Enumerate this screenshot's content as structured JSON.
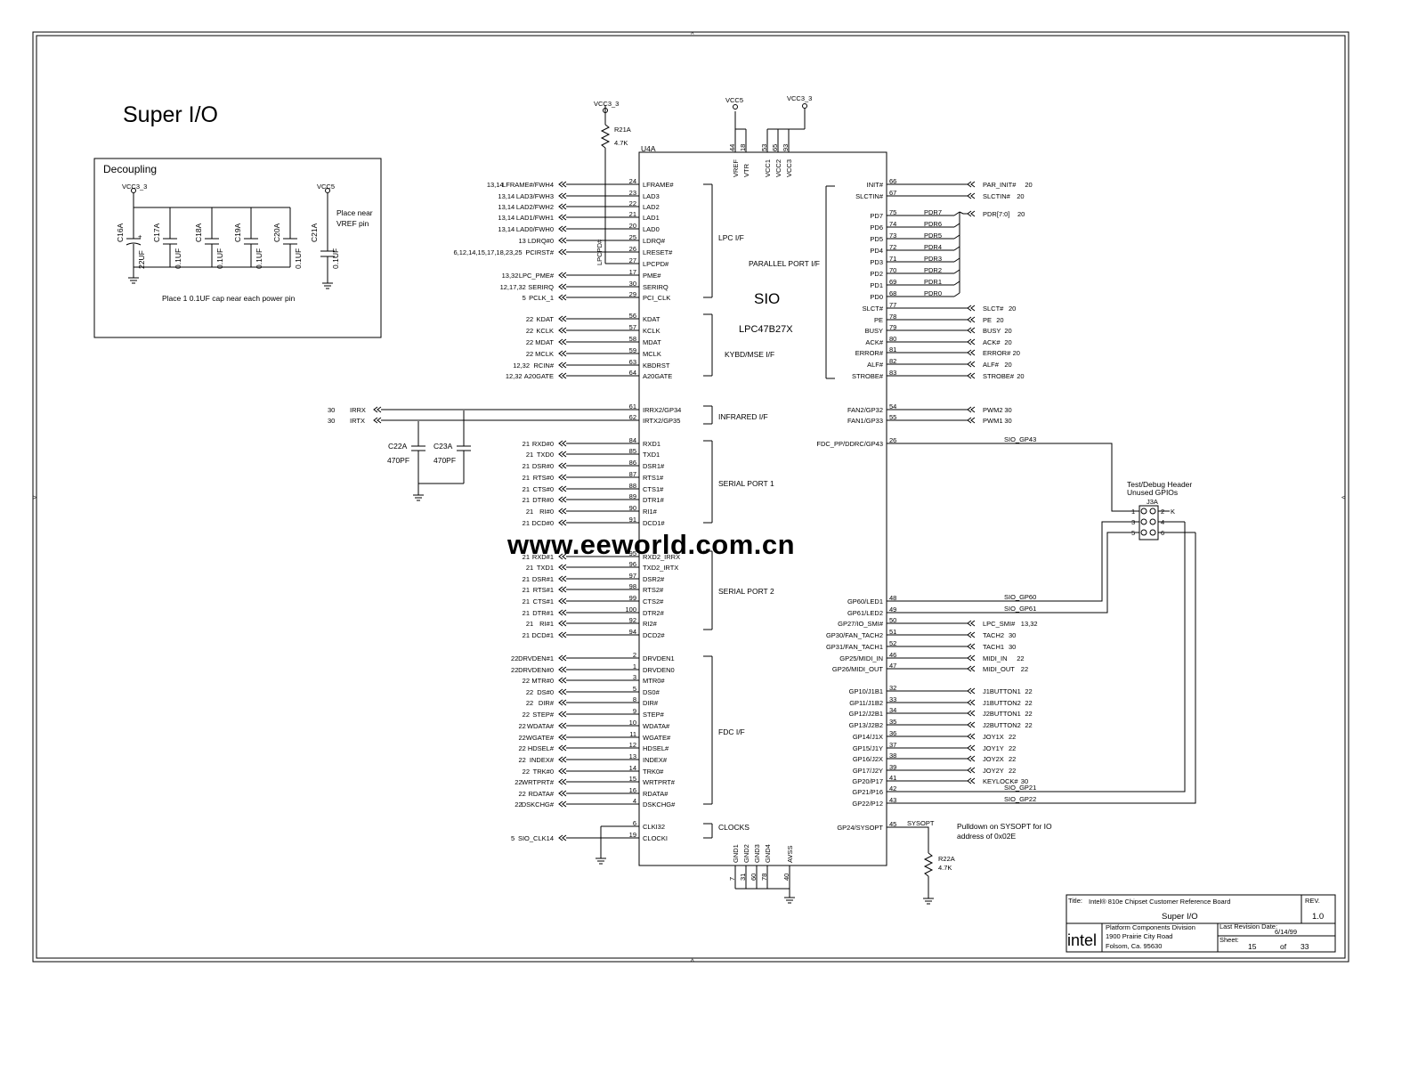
{
  "sheet": {
    "title": "Super I/O"
  },
  "decoupling": {
    "label": "Decoupling",
    "vcc3_label": "VCC3_3",
    "vcc5_label": "VCC5",
    "note_near": "Place near\nVREF pin",
    "note_each": "Place 1 0.1UF cap near each power pin",
    "caps": [
      {
        "ref": "C16A",
        "value": "22UF",
        "polarized": true
      },
      {
        "ref": "C17A",
        "value": "0.1UF"
      },
      {
        "ref": "C18A",
        "value": "0.1UF"
      },
      {
        "ref": "C19A",
        "value": "0.1UF"
      },
      {
        "ref": "C20A",
        "value": "0.1UF"
      },
      {
        "ref": "C21A",
        "value": "0.1UF"
      }
    ]
  },
  "pullup": {
    "rail": "VCC3_3",
    "ref": "R21A",
    "value": "4.7K"
  },
  "chip": {
    "refdes": "U4A",
    "name": "SIO",
    "part": "LPC47B27X",
    "top_rail_left": "VCC5",
    "top_rail_right": "VCC3_3",
    "top_pins": [
      {
        "name": "VREF",
        "num": "44"
      },
      {
        "name": "VTR",
        "num": "18"
      },
      {
        "name": "VCC1",
        "num": "53"
      },
      {
        "name": "VCC2",
        "num": "65"
      },
      {
        "name": "VCC3",
        "num": "93"
      }
    ],
    "bottom_pins": [
      {
        "name": "GND1",
        "num": "7"
      },
      {
        "name": "GND2",
        "num": "31"
      },
      {
        "name": "GND3",
        "num": "60"
      },
      {
        "name": "GND4",
        "num": "78"
      },
      {
        "name": "AVSS",
        "num": "40"
      }
    ],
    "groups": {
      "lpc": "LPC I/F",
      "kybd": "KYBD/MSE I/F",
      "infrared": "INFRARED I/F",
      "serial1": "SERIAL PORT 1",
      "serial2": "SERIAL PORT 2",
      "fdc": "FDC I/F",
      "clocks": "CLOCKS",
      "parallel": "PARALLEL PORT I/F"
    }
  },
  "left_pins": [
    {
      "pin": "LFRAME#",
      "num": "24",
      "net": "LFRAME#/FWH4",
      "ref": "13,14"
    },
    {
      "pin": "LAD3",
      "num": "23",
      "net": "LAD3/FWH3",
      "ref": "13,14"
    },
    {
      "pin": "LAD2",
      "num": "22",
      "net": "LAD2/FWH2",
      "ref": "13,14"
    },
    {
      "pin": "LAD1",
      "num": "21",
      "net": "LAD1/FWH1",
      "ref": "13,14"
    },
    {
      "pin": "LAD0",
      "num": "20",
      "net": "LAD0/FWH0",
      "ref": "13,14"
    },
    {
      "pin": "LDRQ#",
      "num": "25",
      "net": "LDRQ#0",
      "ref": "13"
    },
    {
      "pin": "LRESET#",
      "num": "26",
      "net": "PCIRST#",
      "ref": "6,12,14,15,17,18,23,25"
    },
    {
      "pin": "LPCPD#",
      "num": "27",
      "net": "",
      "ref": ""
    },
    {
      "pin": "PME#",
      "num": "17",
      "net": "LPC_PME#",
      "ref": "13,32"
    },
    {
      "pin": "SERIRQ",
      "num": "30",
      "net": "SERIRQ",
      "ref": "12,17,32"
    },
    {
      "pin": "PCI_CLK",
      "num": "29",
      "net": "PCLK_1",
      "ref": "5"
    },
    {
      "pin": "KDAT",
      "num": "56",
      "net": "KDAT",
      "ref": "22"
    },
    {
      "pin": "KCLK",
      "num": "57",
      "net": "KCLK",
      "ref": "22"
    },
    {
      "pin": "MDAT",
      "num": "58",
      "net": "MDAT",
      "ref": "22"
    },
    {
      "pin": "MCLK",
      "num": "59",
      "net": "MCLK",
      "ref": "22"
    },
    {
      "pin": "KBDRST",
      "num": "63",
      "net": "RCIN#",
      "ref": "12,32"
    },
    {
      "pin": "A20GATE",
      "num": "64",
      "net": "A20GATE",
      "ref": "12,32"
    },
    {
      "pin": "IRRX2/GP34",
      "num": "61",
      "net": "IRRX",
      "ref": "30"
    },
    {
      "pin": "IRTX2/GP35",
      "num": "62",
      "net": "IRTX",
      "ref": "30"
    },
    {
      "pin": "RXD1",
      "num": "84",
      "net": "RXD#0",
      "ref": "21"
    },
    {
      "pin": "TXD1",
      "num": "85",
      "net": "TXD0",
      "ref": "21"
    },
    {
      "pin": "DSR1#",
      "num": "86",
      "net": "DSR#0",
      "ref": "21"
    },
    {
      "pin": "RTS1#",
      "num": "87",
      "net": "RTS#0",
      "ref": "21"
    },
    {
      "pin": "CTS1#",
      "num": "88",
      "net": "CTS#0",
      "ref": "21"
    },
    {
      "pin": "DTR1#",
      "num": "89",
      "net": "DTR#0",
      "ref": "21"
    },
    {
      "pin": "RI1#",
      "num": "90",
      "net": "RI#0",
      "ref": "21"
    },
    {
      "pin": "DCD1#",
      "num": "91",
      "net": "DCD#0",
      "ref": "21"
    },
    {
      "pin": "RXD2_IRRX",
      "num": "95",
      "net": "RXD#1",
      "ref": "21"
    },
    {
      "pin": "TXD2_IRTX",
      "num": "96",
      "net": "TXD1",
      "ref": "21"
    },
    {
      "pin": "DSR2#",
      "num": "97",
      "net": "DSR#1",
      "ref": "21"
    },
    {
      "pin": "RTS2#",
      "num": "98",
      "net": "RTS#1",
      "ref": "21"
    },
    {
      "pin": "CTS2#",
      "num": "99",
      "net": "CTS#1",
      "ref": "21"
    },
    {
      "pin": "DTR2#",
      "num": "100",
      "net": "DTR#1",
      "ref": "21"
    },
    {
      "pin": "RI2#",
      "num": "92",
      "net": "RI#1",
      "ref": "21"
    },
    {
      "pin": "DCD2#",
      "num": "94",
      "net": "DCD#1",
      "ref": "21"
    },
    {
      "pin": "DRVDEN1",
      "num": "2",
      "net": "DRVDEN#1",
      "ref": "22"
    },
    {
      "pin": "DRVDEN0",
      "num": "1",
      "net": "DRVDEN#0",
      "ref": "22"
    },
    {
      "pin": "MTR0#",
      "num": "3",
      "net": "MTR#0",
      "ref": "22"
    },
    {
      "pin": "DS0#",
      "num": "5",
      "net": "DS#0",
      "ref": "22"
    },
    {
      "pin": "DIR#",
      "num": "8",
      "net": "DIR#",
      "ref": "22"
    },
    {
      "pin": "STEP#",
      "num": "9",
      "net": "STEP#",
      "ref": "22"
    },
    {
      "pin": "WDATA#",
      "num": "10",
      "net": "WDATA#",
      "ref": "22"
    },
    {
      "pin": "WGATE#",
      "num": "11",
      "net": "WGATE#",
      "ref": "22"
    },
    {
      "pin": "HDSEL#",
      "num": "12",
      "net": "HDSEL#",
      "ref": "22"
    },
    {
      "pin": "INDEX#",
      "num": "13",
      "net": "INDEX#",
      "ref": "22"
    },
    {
      "pin": "TRK0#",
      "num": "14",
      "net": "TRK#0",
      "ref": "22"
    },
    {
      "pin": "WRTPRT#",
      "num": "15",
      "net": "WRTPRT#",
      "ref": "22"
    },
    {
      "pin": "RDATA#",
      "num": "16",
      "net": "RDATA#",
      "ref": "22"
    },
    {
      "pin": "DSKCHG#",
      "num": "4",
      "net": "DSKCHG#",
      "ref": "22"
    },
    {
      "pin": "CLKI32",
      "num": "6",
      "net": "",
      "ref": ""
    },
    {
      "pin": "CLOCKI",
      "num": "19",
      "net": "SIO_CLK14",
      "ref": "5"
    }
  ],
  "right_pins": [
    {
      "pin": "INIT#",
      "num": "66",
      "net": "PAR_INIT#",
      "ref": "20"
    },
    {
      "pin": "SLCTIN#",
      "num": "67",
      "net": "SLCTIN#",
      "ref": "20"
    },
    {
      "pin": "PD7",
      "num": "75",
      "net": "PDR7",
      "ref": ""
    },
    {
      "pin": "PD6",
      "num": "74",
      "net": "PDR6",
      "ref": ""
    },
    {
      "pin": "PD5",
      "num": "73",
      "net": "PDR5",
      "ref": ""
    },
    {
      "pin": "PD4",
      "num": "72",
      "net": "PDR4",
      "ref": ""
    },
    {
      "pin": "PD3",
      "num": "71",
      "net": "PDR3",
      "ref": ""
    },
    {
      "pin": "PD2",
      "num": "70",
      "net": "PDR2",
      "ref": ""
    },
    {
      "pin": "PD1",
      "num": "69",
      "net": "PDR1",
      "ref": ""
    },
    {
      "pin": "PD0",
      "num": "68",
      "net": "PDR0",
      "ref": ""
    },
    {
      "pin": "SLCT#",
      "num": "77",
      "net": "SLCT#",
      "ref": "20"
    },
    {
      "pin": "PE",
      "num": "78",
      "net": "PE",
      "ref": "20"
    },
    {
      "pin": "BUSY",
      "num": "79",
      "net": "BUSY",
      "ref": "20"
    },
    {
      "pin": "ACK#",
      "num": "80",
      "net": "ACK#",
      "ref": "20"
    },
    {
      "pin": "ERROR#",
      "num": "81",
      "net": "ERROR#",
      "ref": "20"
    },
    {
      "pin": "ALF#",
      "num": "82",
      "net": "ALF#",
      "ref": "20"
    },
    {
      "pin": "STROBE#",
      "num": "83",
      "net": "STROBE#",
      "ref": "20"
    },
    {
      "pin": "FAN2/GP32",
      "num": "54",
      "net": "PWM2",
      "ref": "30"
    },
    {
      "pin": "FAN1/GP33",
      "num": "55",
      "net": "PWM1",
      "ref": "30"
    },
    {
      "pin": "FDC_PP/DDRC/GP43",
      "num": "26",
      "net": "SIO_GP43",
      "ref": ""
    },
    {
      "pin": "GP60/LED1",
      "num": "48",
      "net": "SIO_GP60",
      "ref": ""
    },
    {
      "pin": "GP61/LED2",
      "num": "49",
      "net": "SIO_GP61",
      "ref": ""
    },
    {
      "pin": "GP27/IO_SMI#",
      "num": "50",
      "net": "LPC_SMI#",
      "ref": "13,32"
    },
    {
      "pin": "GP30/FAN_TACH2",
      "num": "51",
      "net": "TACH2",
      "ref": "30"
    },
    {
      "pin": "GP31/FAN_TACH1",
      "num": "52",
      "net": "TACH1",
      "ref": "30"
    },
    {
      "pin": "GP25/MIDI_IN",
      "num": "46",
      "net": "MIDI_IN",
      "ref": "22"
    },
    {
      "pin": "GP26/MIDI_OUT",
      "num": "47",
      "net": "MIDI_OUT",
      "ref": "22"
    },
    {
      "pin": "GP10/J1B1",
      "num": "32",
      "net": "J1BUTTON1",
      "ref": "22"
    },
    {
      "pin": "GP11/J1B2",
      "num": "33",
      "net": "J1BUTTON2",
      "ref": "22"
    },
    {
      "pin": "GP12/J2B1",
      "num": "34",
      "net": "J2BUTTON1",
      "ref": "22"
    },
    {
      "pin": "GP13/J2B2",
      "num": "35",
      "net": "J2BUTTON2",
      "ref": "22"
    },
    {
      "pin": "GP14/J1X",
      "num": "36",
      "net": "JOY1X",
      "ref": "22"
    },
    {
      "pin": "GP15/J1Y",
      "num": "37",
      "net": "JOY1Y",
      "ref": "22"
    },
    {
      "pin": "GP16/J2X",
      "num": "38",
      "net": "JOY2X",
      "ref": "22"
    },
    {
      "pin": "GP17/J2Y",
      "num": "39",
      "net": "JOY2Y",
      "ref": "22"
    },
    {
      "pin": "GP20/P17",
      "num": "41",
      "net": "KEYLOCK#",
      "ref": "30"
    },
    {
      "pin": "GP21/P16",
      "num": "42",
      "net": "SIO_GP21",
      "ref": ""
    },
    {
      "pin": "GP22/P12",
      "num": "43",
      "net": "SIO_GP22",
      "ref": ""
    },
    {
      "pin": "GP24/SYSOPT",
      "num": "45",
      "net": "SYSOPT",
      "ref": ""
    }
  ],
  "pdr_bus": {
    "label": "PDR[7:0]",
    "ref": "20"
  },
  "ir_caps": [
    {
      "ref": "C22A",
      "value": "470PF"
    },
    {
      "ref": "C23A",
      "value": "470PF"
    }
  ],
  "header": {
    "title1": "Test/Debug Header",
    "title2": "Unused GPIOs",
    "ref": "J3A",
    "pins_left": [
      "1",
      "3",
      "5"
    ],
    "pins_right": [
      "2",
      "4",
      "6"
    ],
    "key": "K"
  },
  "pulldown": {
    "note1": "Pulldown on SYSOPT for IO",
    "note2": "address of 0x02E",
    "ref": "R22A",
    "value": "4.7K"
  },
  "title_block": {
    "title_label": "Title:",
    "title": "Intel® 810e Chipset Customer Reference Board",
    "rev_label": "REV.",
    "rev": "1.0",
    "sheet_title": "Super I/O",
    "logo": "intel",
    "address1": "Platform Components Division",
    "address2": "1900 Prairie City Road",
    "address3": "Folsom, Ca. 95630",
    "last_rev_label": "Last Revision Date:",
    "last_rev": "6/14/99",
    "sheet_label": "Sheet:",
    "sheet": "15",
    "of_label": "of",
    "total": "33"
  },
  "watermark": "www.eeworld.com.cn"
}
